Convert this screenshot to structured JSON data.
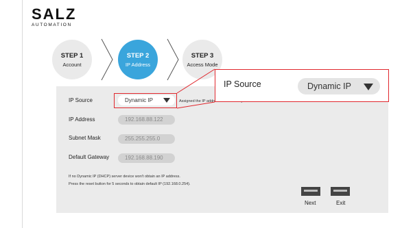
{
  "brand": {
    "name": "SALZ",
    "subtitle": "AUTOMATION"
  },
  "steps": [
    {
      "title": "STEP 1",
      "subtitle": "Account"
    },
    {
      "title": "STEP 2",
      "subtitle": "IP Address"
    },
    {
      "title": "STEP 3",
      "subtitle": "Access Mode"
    }
  ],
  "form": {
    "ip_source": {
      "label": "IP Source",
      "value": "Dynamic IP",
      "hint": "Assigned the IP address automatically to device."
    },
    "ip_address": {
      "label": "IP Address",
      "value": "192.168.88.122"
    },
    "subnet_mask": {
      "label": "Subnet Mask",
      "value": "255.255.255.0"
    },
    "gateway": {
      "label": "Default Gateway",
      "value": "192.168.88.190"
    }
  },
  "notes": [
    "If no Dynamic IP (DHCP) server device won't obtain an IP address.",
    "Press the reset button for 5 seconds to obtain default IP (192.168.0.254)."
  ],
  "buttons": {
    "next": "Next",
    "exit": "Exit"
  },
  "zoom": {
    "label": "IP Source",
    "value": "Dynamic IP"
  },
  "colors": {
    "accent": "#3aa5dc",
    "highlight": "#e0262c"
  }
}
